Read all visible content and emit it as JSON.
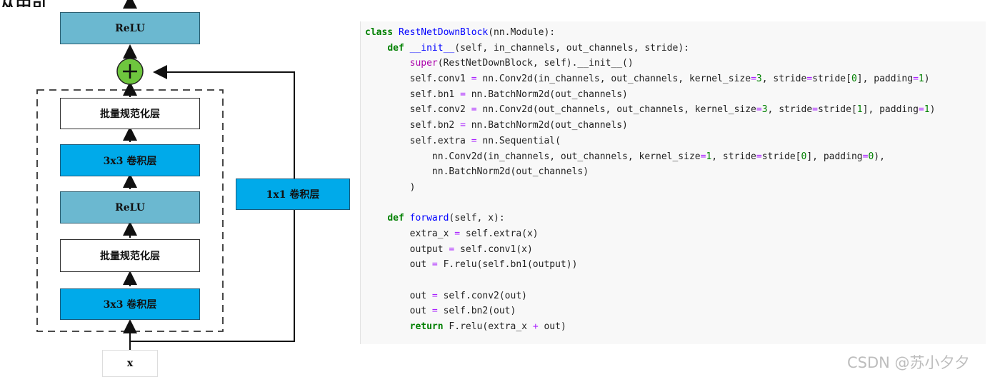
{
  "diagram": {
    "top_partial_text": "从中可",
    "blocks": {
      "relu_top": "ReLU",
      "bn_1": "批量规范化层",
      "conv3_1": "3x3 卷积层",
      "relu_mid": "ReLU",
      "bn_2": "批量规范化层",
      "conv3_2": "3x3 卷积层",
      "conv1x1": "1x1 卷积层",
      "input_x": "x"
    },
    "colors": {
      "conv": "#00aaea",
      "relu": "#6bb8d0",
      "add_node": "#6ec63e",
      "bn": "#ffffff"
    },
    "add_symbol": "+"
  },
  "code": {
    "lines": [
      [
        {
          "t": "class ",
          "c": "kw"
        },
        {
          "t": "RestNetDownBlock",
          "c": "fn"
        },
        {
          "t": "(nn.Module):",
          "c": ""
        }
      ],
      [
        {
          "t": "    ",
          "c": ""
        },
        {
          "t": "def ",
          "c": "kw"
        },
        {
          "t": "__init__",
          "c": "fn"
        },
        {
          "t": "(self, in_channels, out_channels, stride):",
          "c": ""
        }
      ],
      [
        {
          "t": "        ",
          "c": ""
        },
        {
          "t": "super",
          "c": "bi"
        },
        {
          "t": "(RestNetDownBlock, self).__init__()",
          "c": ""
        }
      ],
      [
        {
          "t": "        self.conv1 ",
          "c": ""
        },
        {
          "t": "=",
          "c": "op"
        },
        {
          "t": " nn.Conv2d(in_channels, out_channels, kernel_size",
          "c": ""
        },
        {
          "t": "=",
          "c": "op"
        },
        {
          "t": "3",
          "c": "num"
        },
        {
          "t": ", stride",
          "c": ""
        },
        {
          "t": "=",
          "c": "op"
        },
        {
          "t": "stride[",
          "c": ""
        },
        {
          "t": "0",
          "c": "num"
        },
        {
          "t": "], padding",
          "c": ""
        },
        {
          "t": "=",
          "c": "op"
        },
        {
          "t": "1",
          "c": "num"
        },
        {
          "t": ")",
          "c": ""
        }
      ],
      [
        {
          "t": "        self.bn1 ",
          "c": ""
        },
        {
          "t": "=",
          "c": "op"
        },
        {
          "t": " nn.BatchNorm2d(out_channels)",
          "c": ""
        }
      ],
      [
        {
          "t": "        self.conv2 ",
          "c": ""
        },
        {
          "t": "=",
          "c": "op"
        },
        {
          "t": " nn.Conv2d(out_channels, out_channels, kernel_size",
          "c": ""
        },
        {
          "t": "=",
          "c": "op"
        },
        {
          "t": "3",
          "c": "num"
        },
        {
          "t": ", stride",
          "c": ""
        },
        {
          "t": "=",
          "c": "op"
        },
        {
          "t": "stride[",
          "c": ""
        },
        {
          "t": "1",
          "c": "num"
        },
        {
          "t": "], padding",
          "c": ""
        },
        {
          "t": "=",
          "c": "op"
        },
        {
          "t": "1",
          "c": "num"
        },
        {
          "t": ")",
          "c": ""
        }
      ],
      [
        {
          "t": "        self.bn2 ",
          "c": ""
        },
        {
          "t": "=",
          "c": "op"
        },
        {
          "t": " nn.BatchNorm2d(out_channels)",
          "c": ""
        }
      ],
      [
        {
          "t": "        self.extra ",
          "c": ""
        },
        {
          "t": "=",
          "c": "op"
        },
        {
          "t": " nn.Sequential(",
          "c": ""
        }
      ],
      [
        {
          "t": "            nn.Conv2d(in_channels, out_channels, kernel_size",
          "c": ""
        },
        {
          "t": "=",
          "c": "op"
        },
        {
          "t": "1",
          "c": "num"
        },
        {
          "t": ", stride",
          "c": ""
        },
        {
          "t": "=",
          "c": "op"
        },
        {
          "t": "stride[",
          "c": ""
        },
        {
          "t": "0",
          "c": "num"
        },
        {
          "t": "], padding",
          "c": ""
        },
        {
          "t": "=",
          "c": "op"
        },
        {
          "t": "0",
          "c": "num"
        },
        {
          "t": "),",
          "c": ""
        }
      ],
      [
        {
          "t": "            nn.BatchNorm2d(out_channels)",
          "c": ""
        }
      ],
      [
        {
          "t": "        )",
          "c": ""
        }
      ],
      [
        {
          "t": "",
          "c": ""
        }
      ],
      [
        {
          "t": "    ",
          "c": ""
        },
        {
          "t": "def ",
          "c": "kw"
        },
        {
          "t": "forward",
          "c": "fn"
        },
        {
          "t": "(self, x):",
          "c": ""
        }
      ],
      [
        {
          "t": "        extra_x ",
          "c": ""
        },
        {
          "t": "=",
          "c": "op"
        },
        {
          "t": " self.extra(x)",
          "c": ""
        }
      ],
      [
        {
          "t": "        output ",
          "c": ""
        },
        {
          "t": "=",
          "c": "op"
        },
        {
          "t": " self.conv1(x)",
          "c": ""
        }
      ],
      [
        {
          "t": "        out ",
          "c": ""
        },
        {
          "t": "=",
          "c": "op"
        },
        {
          "t": " F.relu(self.bn1(output))",
          "c": ""
        }
      ],
      [
        {
          "t": "",
          "c": ""
        }
      ],
      [
        {
          "t": "        out ",
          "c": ""
        },
        {
          "t": "=",
          "c": "op"
        },
        {
          "t": " self.conv2(out)",
          "c": ""
        }
      ],
      [
        {
          "t": "        out ",
          "c": ""
        },
        {
          "t": "=",
          "c": "op"
        },
        {
          "t": " self.bn2(out)",
          "c": ""
        }
      ],
      [
        {
          "t": "        ",
          "c": ""
        },
        {
          "t": "return ",
          "c": "kw"
        },
        {
          "t": "F.relu(extra_x ",
          "c": ""
        },
        {
          "t": "+",
          "c": "op"
        },
        {
          "t": " out)",
          "c": ""
        }
      ]
    ]
  },
  "watermark": "CSDN @苏小夕夕"
}
